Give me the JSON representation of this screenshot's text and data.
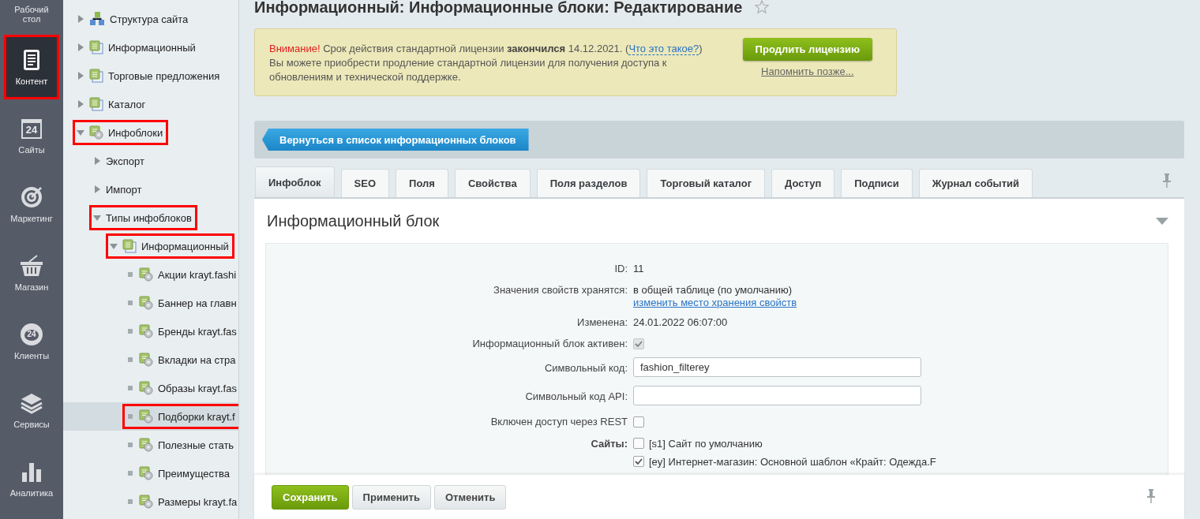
{
  "nav": [
    {
      "kind": "desktop",
      "label": "Рабочий стол",
      "selected": false,
      "highlighted": false
    },
    {
      "kind": "content",
      "label": "Контент",
      "selected": true,
      "highlighted": true
    },
    {
      "kind": "calendar",
      "label": "Сайты",
      "badge": "24",
      "selected": false,
      "highlighted": false
    },
    {
      "kind": "target",
      "label": "Маркетинг",
      "selected": false,
      "highlighted": false
    },
    {
      "kind": "basket",
      "label": "Магазин",
      "selected": false,
      "highlighted": false
    },
    {
      "kind": "cloud",
      "label": "Клиенты",
      "badge": "24",
      "selected": false,
      "highlighted": false
    },
    {
      "kind": "layers",
      "label": "Сервисы",
      "selected": false,
      "highlighted": false
    },
    {
      "kind": "chart",
      "label": "Аналитика",
      "selected": false,
      "highlighted": false
    }
  ],
  "tree": [
    {
      "label": "Структура сайта",
      "kind": "structure",
      "expanded": false,
      "selected": false,
      "highlighted": false
    },
    {
      "label": "Информационный",
      "kind": "block",
      "expanded": false,
      "selected": false,
      "highlighted": false
    },
    {
      "label": "Торговые предложения",
      "kind": "block",
      "expanded": false,
      "selected": false,
      "highlighted": false
    },
    {
      "label": "Каталог",
      "kind": "block",
      "expanded": false,
      "selected": false,
      "highlighted": false
    },
    {
      "label": "Инфоблоки",
      "kind": "block-gear",
      "expanded": true,
      "selected": false,
      "highlighted": true,
      "children": [
        {
          "label": "Экспорт",
          "expanded": false,
          "selected": false,
          "highlighted": false
        },
        {
          "label": "Импорт",
          "expanded": false,
          "selected": false,
          "highlighted": false
        },
        {
          "label": "Типы инфоблоков",
          "expanded": true,
          "selected": false,
          "highlighted": true,
          "children": [
            {
              "label": "Информационный",
              "kind": "block",
              "expanded": true,
              "selected": false,
              "highlighted": true,
              "children": [
                {
                  "label": "Акции krayt.fashi",
                  "kind": "block-gear",
                  "selected": false,
                  "highlighted": false
                },
                {
                  "label": "Баннер на главн",
                  "kind": "block-gear",
                  "selected": false,
                  "highlighted": false
                },
                {
                  "label": "Бренды krayt.fas",
                  "kind": "block-gear",
                  "selected": false,
                  "highlighted": false
                },
                {
                  "label": "Вкладки на стра",
                  "kind": "block-gear",
                  "selected": false,
                  "highlighted": false
                },
                {
                  "label": "Образы krayt.fas",
                  "kind": "block-gear",
                  "selected": false,
                  "highlighted": false
                },
                {
                  "label": "Подборки krayt.f",
                  "kind": "block-gear",
                  "selected": true,
                  "highlighted": true
                },
                {
                  "label": "Полезные стать",
                  "kind": "block-gear",
                  "selected": false,
                  "highlighted": false
                },
                {
                  "label": "Преимущества",
                  "kind": "block-gear",
                  "selected": false,
                  "highlighted": false
                },
                {
                  "label": "Размеры krayt.fa",
                  "kind": "block-gear",
                  "selected": false,
                  "highlighted": false
                }
              ]
            }
          ]
        }
      ]
    }
  ],
  "page": {
    "title": "Информационный: Информационные блоки: Редактирование",
    "favorite": false
  },
  "notice": {
    "alert": "Внимание!",
    "text": "Срок действия стандартной лицензии **закончился** 14.12.2021. (",
    "link": "Что это такое?",
    "text_after": ")",
    "text_2": "Вы можете приобрести продление стандартной лицензии для получения доступа к обновлениям и технической поддержке.",
    "button": "Продлить лицензию",
    "remind": "Напомнить позже..."
  },
  "back_button": "Вернуться в список информационных блоков",
  "tabs": [
    {
      "label": "Инфоблок",
      "selected": true
    },
    {
      "label": "SEO",
      "selected": false
    },
    {
      "label": "Поля",
      "selected": false
    },
    {
      "label": "Свойства",
      "selected": false
    },
    {
      "label": "Поля разделов",
      "selected": false
    },
    {
      "label": "Торговый каталог",
      "selected": false
    },
    {
      "label": "Доступ",
      "selected": false
    },
    {
      "label": "Подписи",
      "selected": false
    },
    {
      "label": "Журнал событий",
      "selected": false
    }
  ],
  "section": {
    "title": "Информационный блок",
    "expanded": true
  },
  "form": [
    {
      "kind": "text",
      "label": "ID:",
      "value": "11"
    },
    {
      "kind": "text_link",
      "label": "Значения свойств хранятся:",
      "value": "в общей таблице (по умолчанию)",
      "link": "изменить место хранения свойств"
    },
    {
      "kind": "text",
      "label": "Изменена:",
      "value": "24.01.2022 06:07:00"
    },
    {
      "kind": "checkbox",
      "label": "Информационный блок активен:",
      "checked": true,
      "disabled": true
    },
    {
      "kind": "input",
      "label": "Символьный код:",
      "value": "fashion_filterey"
    },
    {
      "kind": "input",
      "label": "Символьный код API:"
    },
    {
      "kind": "checkbox",
      "label": "Включен доступ через REST",
      "checked": false
    },
    {
      "kind": "sites",
      "label": "Сайты:",
      "options": [
        {
          "label": "[s1] Сайт по умолчанию",
          "checked": false
        },
        {
          "label": "[ey] Интернет-магазин: Основной шаблон «Крайт: Одежда.F",
          "checked": true
        }
      ]
    }
  ],
  "footer": {
    "buttons": [
      {
        "kind": "primary",
        "label": "Сохранить"
      },
      {
        "kind": "default",
        "label": "Применить"
      },
      {
        "kind": "default",
        "label": "Отменить"
      }
    ]
  }
}
